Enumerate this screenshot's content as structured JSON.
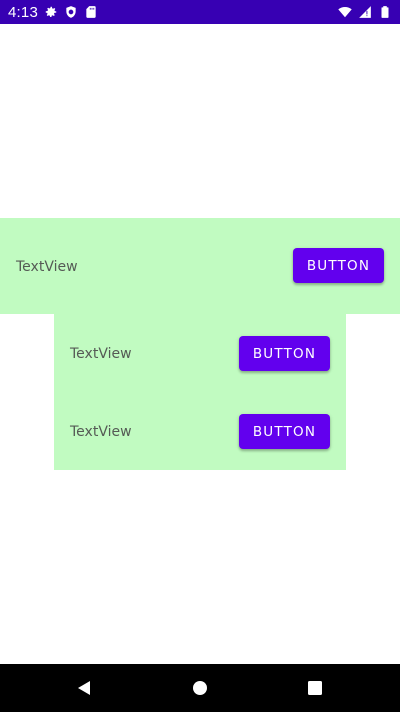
{
  "status_bar": {
    "time": "4:13",
    "left_icons": [
      "gear-icon",
      "shield-icon",
      "sd-card-icon"
    ],
    "right_icons": [
      "wifi-icon",
      "signal-icon",
      "battery-icon"
    ],
    "background": "#3700b3"
  },
  "content": {
    "accent_background": "#c1fbc1",
    "rows": [
      {
        "text": "TextView",
        "button_label": "BUTTON"
      },
      {
        "text": "TextView",
        "button_label": "BUTTON"
      },
      {
        "text": "TextView",
        "button_label": "BUTTON"
      }
    ],
    "button_color": "#6200ee"
  },
  "navigation_bar": {
    "buttons": [
      "back-icon",
      "home-icon",
      "recents-icon"
    ]
  }
}
